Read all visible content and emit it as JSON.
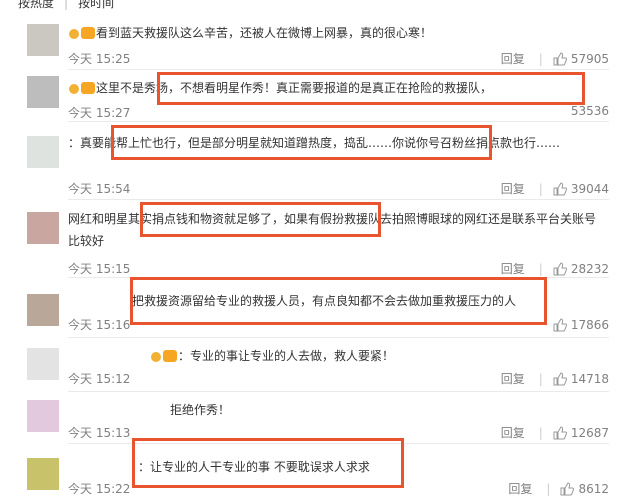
{
  "sort_tabs": [
    "按热度",
    "按时间"
  ],
  "comments": [
    {
      "text": "看到蓝天救援队这么辛苦，还被人在微博上网暴，真的很心寒！",
      "time": "今天 15:25",
      "reply": "回复",
      "likes": "57905"
    },
    {
      "text": "这里不是秀场，不想看明星作秀！真正需要报道的是真正在抢险的救援队，",
      "time": "今天 15:27",
      "reply": "回复",
      "likes": "53536"
    },
    {
      "text": "：真要能帮上忙也行，但是部分明星就知道蹭热度，捣乱……你说你号召粉丝捐点款也行……",
      "time": "今天 15:54",
      "reply": "回复",
      "likes": "39044"
    },
    {
      "text": "网红和明星其实捐点钱和物资就足够了，如果有假扮救援队去拍照博眼球的网红还是联系平台关账号比较好",
      "time": "今天 15:15",
      "reply": "回复",
      "likes": "28232"
    },
    {
      "text": "把救援资源留给专业的救援人员，有点良知都不会去做加重救援压力的人",
      "time": "今天 15:16",
      "reply": "回复",
      "likes": "17866"
    },
    {
      "text": "：专业的事让专业的人去做，救人要紧！",
      "time": "今天 15:12",
      "reply": "回复",
      "likes": "14718"
    },
    {
      "text": "拒绝作秀！",
      "time": "今天 15:13",
      "reply": "回复",
      "likes": "12687"
    },
    {
      "text": "：让专业的人干专业的事 不要耽误求人求求",
      "time": "今天 15:22",
      "reply": "回复",
      "likes": "8612"
    }
  ],
  "colors": {
    "highlight": "#e8542d",
    "meta_text": "#808080"
  },
  "icons": {
    "like": "thumbs-up-icon",
    "badge": "vip-badge-icon"
  }
}
